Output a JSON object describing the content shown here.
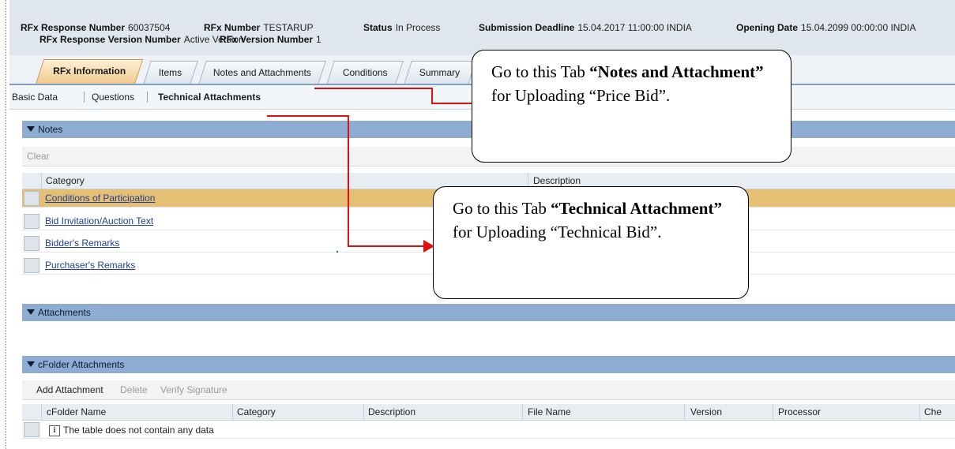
{
  "header": {
    "rfx_response_number_label": "RFx Response Number",
    "rfx_response_number_value": "60037504",
    "rfx_number_label": "RFx Number",
    "rfx_number_value": "TESTARUP",
    "status_label": "Status",
    "status_value": "In Process",
    "submission_deadline_label": "Submission Deadline",
    "submission_deadline_value": "15.04.2017 11:00:00 INDIA",
    "opening_date_label": "Opening Date",
    "opening_date_value": "15.04.2099 00:00:00 INDIA",
    "response_version_label": "RFx Response Version Number",
    "response_version_value": "Active Version",
    "rfx_version_label": "RFx Version Number",
    "rfx_version_value": "1"
  },
  "tabs": [
    {
      "label": "RFx Information",
      "active": true
    },
    {
      "label": "Items",
      "active": false
    },
    {
      "label": "Notes and Attachments",
      "active": false
    },
    {
      "label": "Conditions",
      "active": false
    },
    {
      "label": "Summary",
      "active": false
    }
  ],
  "subtabs": [
    {
      "label": "Basic Data"
    },
    {
      "label": "Questions"
    },
    {
      "label": "Technical Attachments"
    }
  ],
  "notes": {
    "title": "Notes",
    "toolbar": {
      "clear_label": "Clear"
    },
    "columns": [
      "Category",
      "Description"
    ],
    "rows": [
      {
        "category": "Conditions of Participation",
        "selected": true
      },
      {
        "category": "Bid Invitation/Auction Text",
        "selected": false
      },
      {
        "category": "Bidder's Remarks",
        "selected": false
      },
      {
        "category": "Purchaser's Remarks",
        "selected": false
      }
    ]
  },
  "attachments": {
    "title": "Attachments"
  },
  "cfolder": {
    "title": "cFolder Attachments",
    "toolbar": {
      "add_label": "Add Attachment",
      "delete_label": "Delete",
      "verify_label": "Verify Signature"
    },
    "columns": [
      "cFolder Name",
      "Category",
      "Description",
      "File Name",
      "Version",
      "Processor",
      "Che"
    ],
    "empty_message": "The table does not contain any data",
    "info_icon_glyph": "i"
  },
  "callouts": {
    "notes_tab": {
      "pre": "Go to this Tab ",
      "bold": "“Notes and Attachment”",
      "post": " for Uploading “Price Bid”."
    },
    "technical_tab": {
      "pre": "Go to this Tab ",
      "bold": "“Technical Attachment”",
      "post": " for Uploading “Technical Bid”."
    }
  },
  "colors": {
    "section_bar": "#8fadd3",
    "selected_row": "#e5bf74",
    "arrow": "#e01010",
    "link": "#1f3f8f"
  }
}
